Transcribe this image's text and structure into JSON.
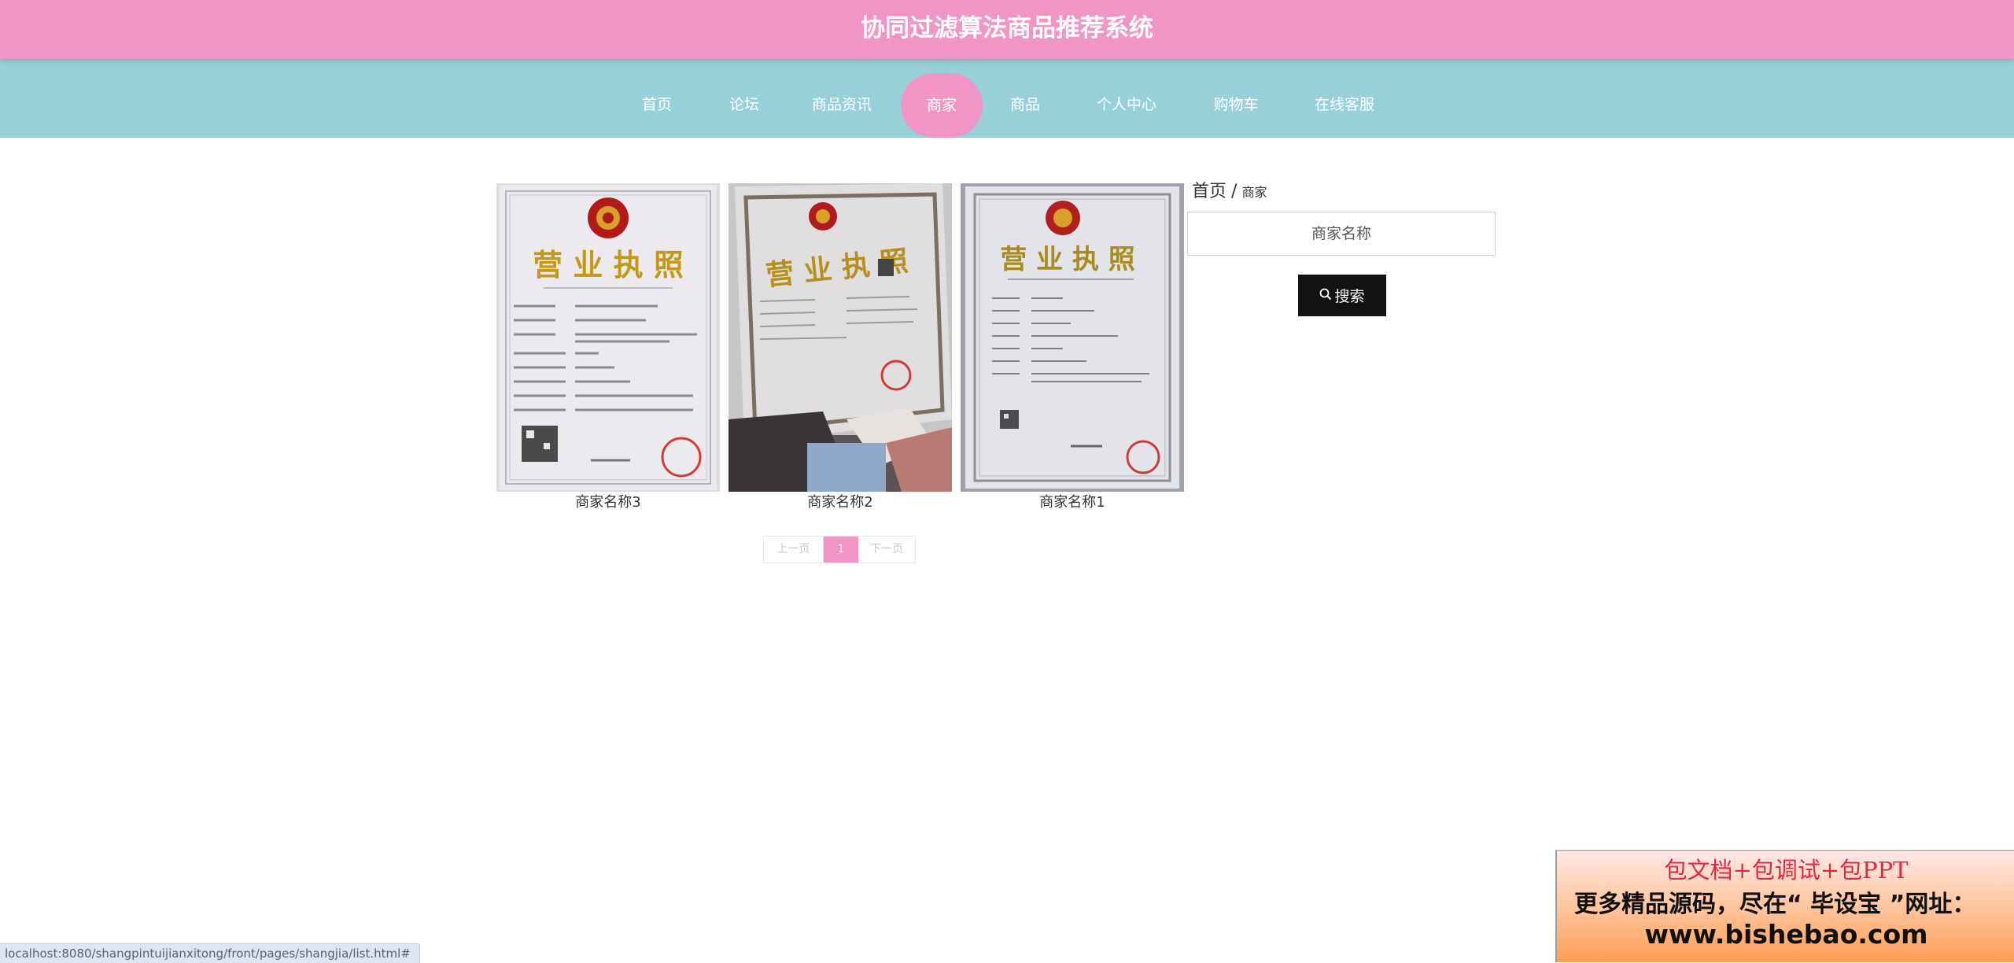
{
  "header": {
    "title": "协同过滤算法商品推荐系统"
  },
  "nav": {
    "items": [
      {
        "label": "首页"
      },
      {
        "label": "论坛"
      },
      {
        "label": "商品资讯"
      },
      {
        "label": "商家",
        "active": true
      },
      {
        "label": "商品"
      },
      {
        "label": "个人中心"
      },
      {
        "label": "购物车"
      },
      {
        "label": "在线客服"
      }
    ],
    "active_color": "#f195c6"
  },
  "merchants": [
    {
      "name": "商家名称3",
      "image_text": {
        "title": "营 业 执 照"
      }
    },
    {
      "name": "商家名称2",
      "image_text": {
        "title": "营 业 执 照"
      }
    },
    {
      "name": "商家名称1",
      "image_text": {
        "title": "营 业 执 照"
      }
    }
  ],
  "pagination": {
    "prev": "上一页",
    "current": "1",
    "next": "下一页"
  },
  "breadcrumb": {
    "home": "首页",
    "separator": "/",
    "current": "商家"
  },
  "search": {
    "placeholder": "商家名称",
    "button_label": "搜索"
  },
  "status_bar": {
    "url": "localhost:8080/shangpintuijianxitong/front/pages/shangjia/list.html#"
  },
  "ad": {
    "line1": "包文档+包调试+包PPT",
    "line2": "更多精品源码，尽在“ 毕设宝 ”网址：",
    "line3": "www.bishebao.com"
  },
  "colors": {
    "title_bar": "#f195c6",
    "nav_bar": "#97d0d9",
    "search_button": "#121212"
  }
}
